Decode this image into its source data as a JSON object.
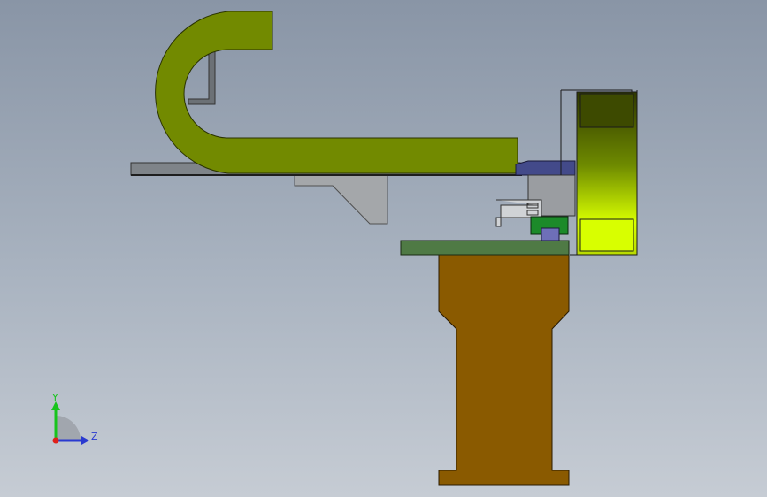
{
  "scene": {
    "description_colors": {
      "background_top": "#8995a6",
      "background_bottom": "#c6ccd4",
      "c_bracket": "#728a00",
      "tray": "#8a8f95",
      "grey_block": "#a4a7aa",
      "motor_dark": "#3d4a00",
      "motor_light": "#d8ff00",
      "mount_blue": "#434a8a",
      "slider_green": "#1c8a2a",
      "plate_green": "#4f7a45",
      "pedestal": "#8a5a00"
    }
  },
  "triad": {
    "y_label": "Y",
    "z_label": "Z",
    "y_color": "#17c41c",
    "z_color": "#2a3ad0",
    "origin_color": "#e0201a"
  }
}
